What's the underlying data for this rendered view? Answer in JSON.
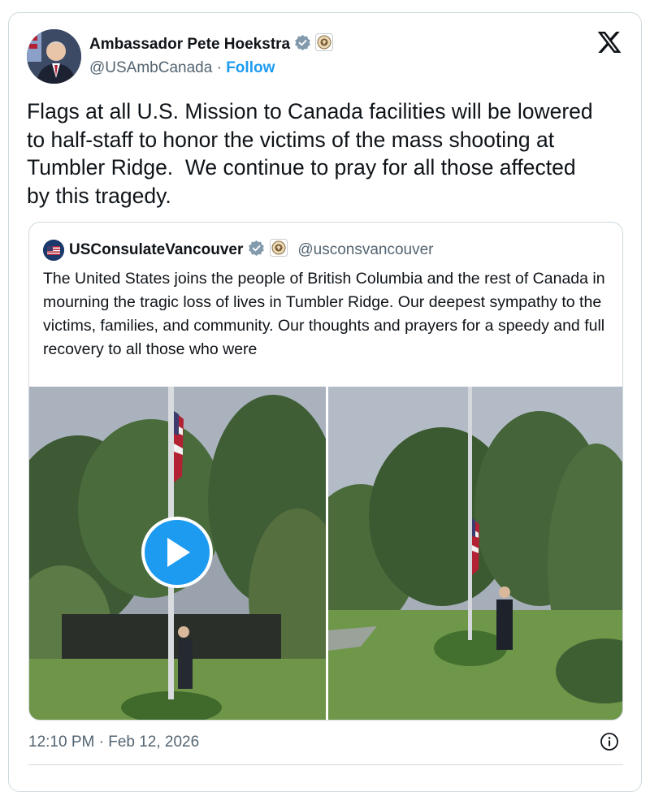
{
  "author": {
    "name": "Ambassador Pete Hoekstra",
    "handle": "@USAmbCanada",
    "separator": "·",
    "follow_label": "Follow"
  },
  "tweet": {
    "text": "Flags at all U.S. Mission to Canada facilities will be lowered\nto half-staff to honor the victims of the mass shooting at\nTumbler Ridge.  We continue to pray for all those affected\nby this tragedy."
  },
  "quoted": {
    "name": "USConsulateVancouver",
    "handle": "@usconsvancouver",
    "text": "The United States joins the people of British Columbia and the rest of Canada in mourning the tragic loss of lives in Tumbler Ridge.  Our deepest sympathy to the victims, families, and community.  Our thoughts and prayers for a speedy and full recovery to all those who were"
  },
  "timestamp": "12:10 PM · Feb 12, 2026",
  "colors": {
    "accent": "#1d9bf0",
    "verified": "#829aab",
    "text": "#0f1419",
    "muted": "#536471",
    "border": "#cfd9de"
  },
  "icons": [
    "x-logo-icon",
    "verified-badge-icon",
    "government-seal-icon",
    "play-icon",
    "info-icon",
    "us-flag-icon"
  ]
}
